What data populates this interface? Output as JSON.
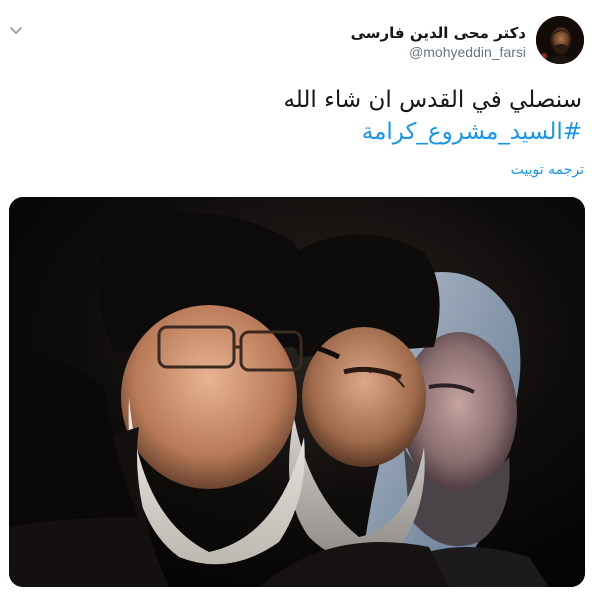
{
  "tweet": {
    "author": {
      "display_name": "دکتر محی الدین فارسی",
      "screen_name": "@mohyeddin_farsi"
    },
    "text": "سنصلي في القدس ان شاء الله",
    "hashtag": "#السيد_مشروع_كرامة",
    "translate_label": "ترجمه توییت"
  },
  "icons": {
    "caret": "chevron-down-icon"
  },
  "colors": {
    "link": "#1b95e0",
    "muted": "#657786",
    "text": "#14171a",
    "background": "#ffffff"
  }
}
